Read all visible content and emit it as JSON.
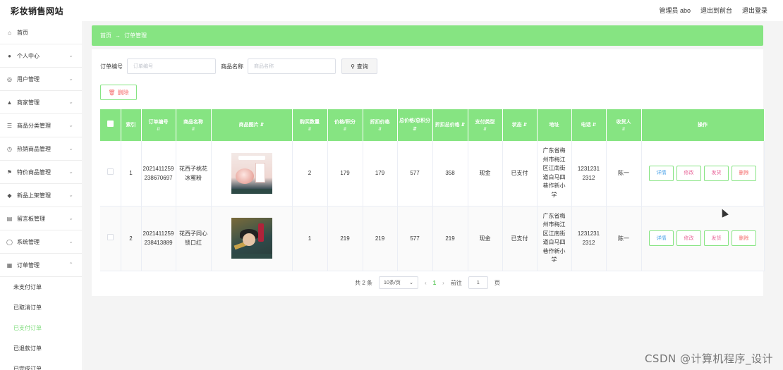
{
  "header": {
    "brand": "彩妆销售网站",
    "admin": "管理员 abo",
    "to_front": "退出到前台",
    "logout": "退出登录"
  },
  "sidebar": {
    "items": [
      {
        "label": "首页",
        "icon": "home-icon",
        "glyph": "⌂"
      },
      {
        "label": "个人中心",
        "icon": "user-icon",
        "glyph": "●"
      },
      {
        "label": "用户管理",
        "icon": "users-icon",
        "glyph": "◎"
      },
      {
        "label": "商家管理",
        "icon": "store-icon",
        "glyph": "▲"
      },
      {
        "label": "商品分类管理",
        "icon": "list-icon",
        "glyph": "☰"
      },
      {
        "label": "热销商品管理",
        "icon": "clock-icon",
        "glyph": "◷"
      },
      {
        "label": "特价商品管理",
        "icon": "flag-icon",
        "glyph": "⚑"
      },
      {
        "label": "新品上架管理",
        "icon": "pin-icon",
        "glyph": "◆"
      },
      {
        "label": "留言板管理",
        "icon": "doc-icon",
        "glyph": "▤"
      },
      {
        "label": "系统管理",
        "icon": "settings-icon",
        "glyph": "◯"
      },
      {
        "label": "订单管理",
        "icon": "grid-icon",
        "glyph": "▦"
      }
    ],
    "sub_items": [
      "未支付订单",
      "已取消订单",
      "已支付订单",
      "已退款订单",
      "已完成订单"
    ]
  },
  "breadcrumb": {
    "home": "首页",
    "sep": "→",
    "current": "订单管理"
  },
  "search": {
    "order_no_label": "订单编号",
    "order_no_placeholder": "订单编号",
    "product_label": "商品名称",
    "product_placeholder": "商品名称",
    "query_button": "查询"
  },
  "toolbar": {
    "delete_button": "删除"
  },
  "table": {
    "columns": [
      "",
      "索引",
      "订单编号",
      "商品名称",
      "商品图片",
      "购买数量",
      "价格/积分",
      "折扣价格",
      "总价格/总积分",
      "折扣总价格",
      "支付类型",
      "状态",
      "地址",
      "电话",
      "收货人",
      "操作"
    ],
    "rows": [
      {
        "index": "1",
        "order_no": "2021411259238670697",
        "product": "花西子桃花冰蜜粉",
        "qty": "2",
        "price": "179",
        "discount_price": "179",
        "total": "577",
        "discount_total": "358",
        "pay_type": "现金",
        "status": "已支付",
        "address": "广东省梅州市梅江区江南街道白马四巷作新小学",
        "phone": "12312312312",
        "receiver": "陈一"
      },
      {
        "index": "2",
        "order_no": "2021411259238413889",
        "product": "花西子同心锁口红",
        "qty": "1",
        "price": "219",
        "discount_price": "219",
        "total": "577",
        "discount_total": "219",
        "pay_type": "现金",
        "status": "已支付",
        "address": "广东省梅州市梅江区江南街道白马四巷作新小学",
        "phone": "12312312312",
        "receiver": "陈一"
      }
    ],
    "ops": {
      "detail": "详情",
      "edit": "修改",
      "ship": "发货",
      "remove": "删除"
    }
  },
  "pager": {
    "total": "共 2 条",
    "page_size": "10条/页",
    "current": "1",
    "goto_label": "前往",
    "goto_value": "1",
    "page_suffix": "页"
  },
  "watermark": "CSDN @计算机程序_设计",
  "colors": {
    "accent": "#86e482",
    "active": "#7ddc7a"
  }
}
